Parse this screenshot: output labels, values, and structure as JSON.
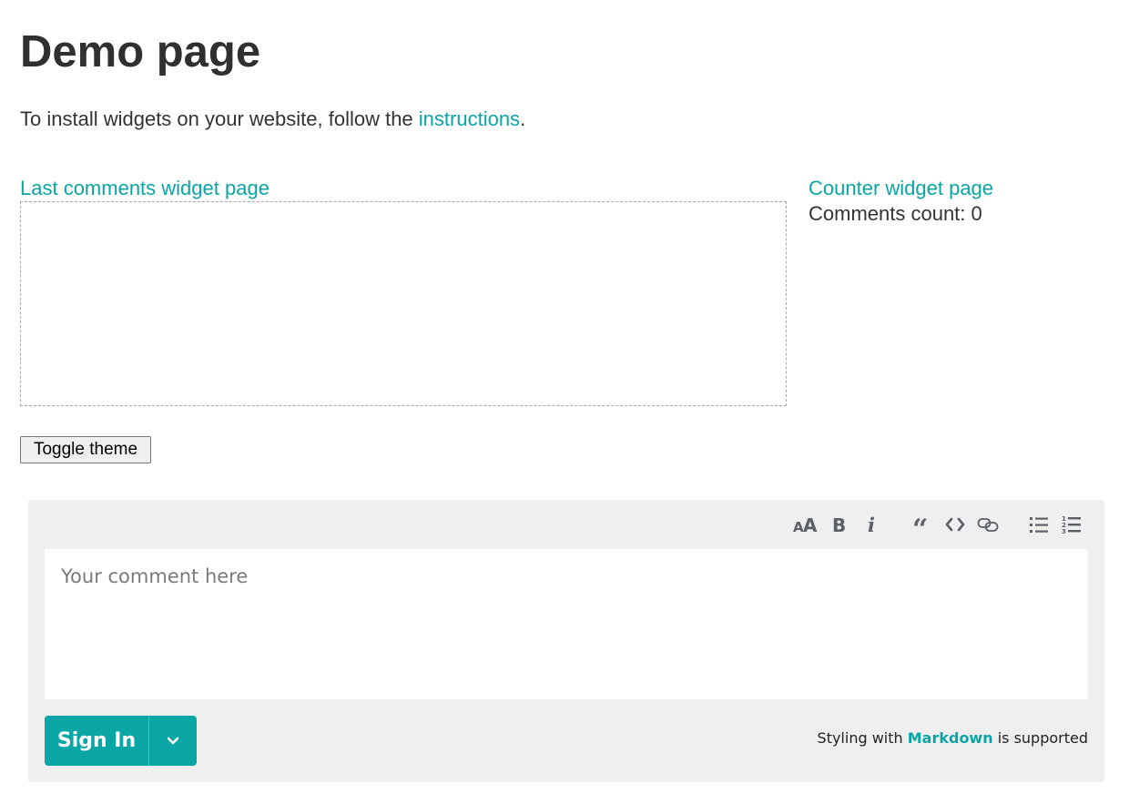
{
  "page": {
    "title": "Demo page",
    "intro_prefix": "To install widgets on your website, follow the ",
    "intro_link": "instructions",
    "intro_suffix": "."
  },
  "widgets": {
    "last_comments_link": "Last comments widget page",
    "counter_link": "Counter widget page",
    "counter_label": "Comments count: ",
    "counter_value": "0"
  },
  "controls": {
    "toggle_theme": "Toggle theme"
  },
  "editor": {
    "toolbar": [
      {
        "name": "header-icon",
        "label": "AA"
      },
      {
        "name": "bold-icon",
        "label": "B"
      },
      {
        "name": "italic-icon",
        "label": "i"
      },
      {
        "name": "quote-icon",
        "label": "quote"
      },
      {
        "name": "code-icon",
        "label": "code"
      },
      {
        "name": "link-icon",
        "label": "link"
      },
      {
        "name": "unordered-list-icon",
        "label": "bulleted list"
      },
      {
        "name": "ordered-list-icon",
        "label": "numbered list"
      }
    ],
    "placeholder": "Your comment here",
    "value": "",
    "signin_label": "Sign In",
    "markdown_prefix": "Styling with ",
    "markdown_link": "Markdown",
    "markdown_suffix": " is supported"
  },
  "colors": {
    "accent": "#0aa5a5",
    "editor_bg": "#efefef",
    "text": "#333333"
  }
}
